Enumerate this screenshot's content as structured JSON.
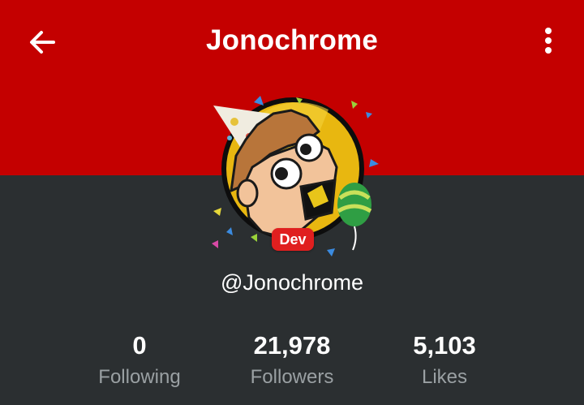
{
  "header": {
    "title": "Jonochrome",
    "back_icon": "arrow-left-icon",
    "menu_icon": "more-vertical-icon",
    "background_color": "#c40000"
  },
  "profile": {
    "handle": "@Jonochrome",
    "badge": "Dev",
    "badge_color": "#e01f1f",
    "avatar_icon": "cartoon-avatar-party"
  },
  "stats": [
    {
      "value": "0",
      "label": "Following"
    },
    {
      "value": "21,978",
      "label": "Followers"
    },
    {
      "value": "5,103",
      "label": "Likes"
    }
  ],
  "colors": {
    "background": "#2b2f31",
    "label_gray": "#9aa0a3"
  }
}
